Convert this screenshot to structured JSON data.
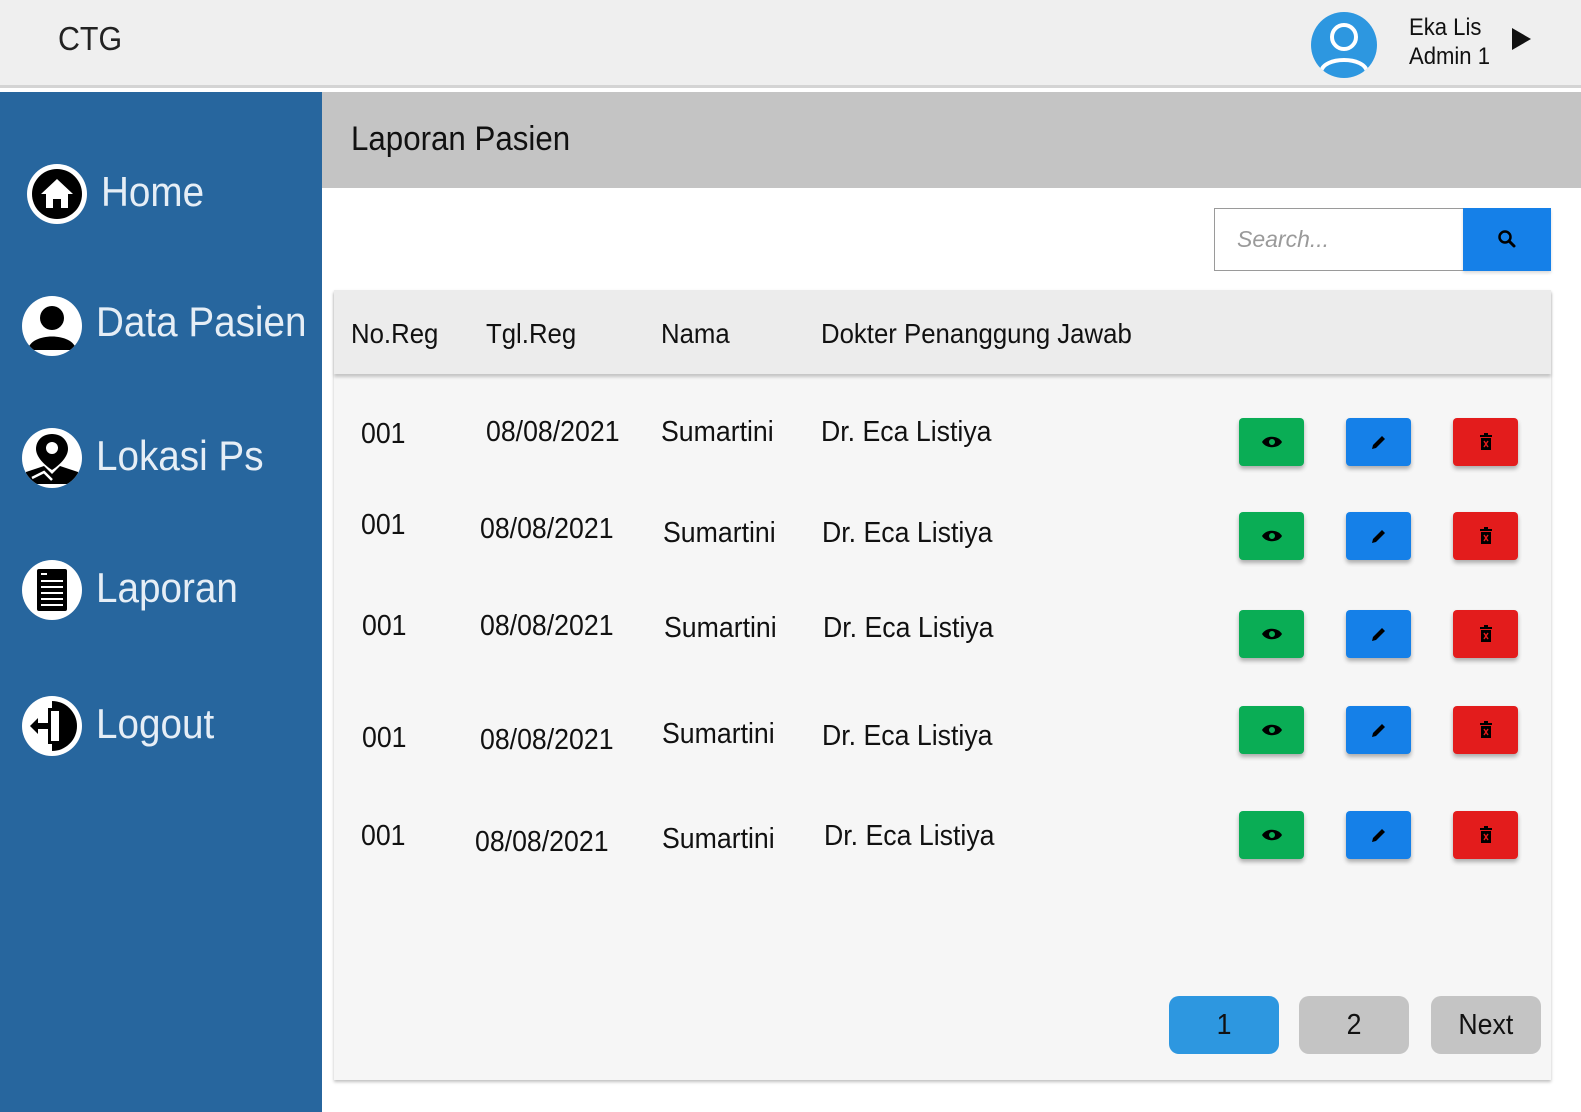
{
  "app": {
    "brand": "CTG"
  },
  "user": {
    "name": "Eka Lis",
    "role": "Admin 1"
  },
  "sidebar": {
    "items": [
      {
        "label": "Home",
        "icon": "home-icon"
      },
      {
        "label": "Data Pasien",
        "icon": "user-icon"
      },
      {
        "label": "Lokasi Ps",
        "icon": "location-map-icon"
      },
      {
        "label": "Laporan",
        "icon": "document-icon"
      },
      {
        "label": "Logout",
        "icon": "logout-icon"
      }
    ]
  },
  "page": {
    "title": "Laporan Pasien"
  },
  "search": {
    "placeholder": "Search...",
    "icon": "search-icon"
  },
  "table": {
    "headers": [
      "No.Reg",
      "Tgl.Reg",
      "Nama",
      "Dokter Penanggung Jawab"
    ],
    "rows": [
      {
        "no_reg": "001",
        "tgl_reg": "08/08/2021",
        "nama": "Sumartini",
        "dokter": "Dr. Eca Listiya"
      },
      {
        "no_reg": "001",
        "tgl_reg": "08/08/2021",
        "nama": "Sumartini",
        "dokter": "Dr. Eca Listiya"
      },
      {
        "no_reg": "001",
        "tgl_reg": "08/08/2021",
        "nama": "Sumartini",
        "dokter": "Dr. Eca Listiya"
      },
      {
        "no_reg": "001",
        "tgl_reg": "08/08/2021",
        "nama": "Sumartini",
        "dokter": "Dr. Eca Listiya"
      },
      {
        "no_reg": "001",
        "tgl_reg": "08/08/2021",
        "nama": "Sumartini",
        "dokter": "Dr. Eca Listiya"
      }
    ],
    "actions": [
      "eye-icon",
      "pencil-icon",
      "trash-icon"
    ]
  },
  "pagination": {
    "pages": [
      "1",
      "2"
    ],
    "current": "1",
    "next_label": "Next"
  },
  "colors": {
    "sidebar": "#27669e",
    "accent_blue": "#1580e8",
    "page_active": "#2d97e0",
    "view_green": "#0aad55",
    "delete_red": "#e31c1c",
    "header_gray": "#c4c4c4"
  }
}
